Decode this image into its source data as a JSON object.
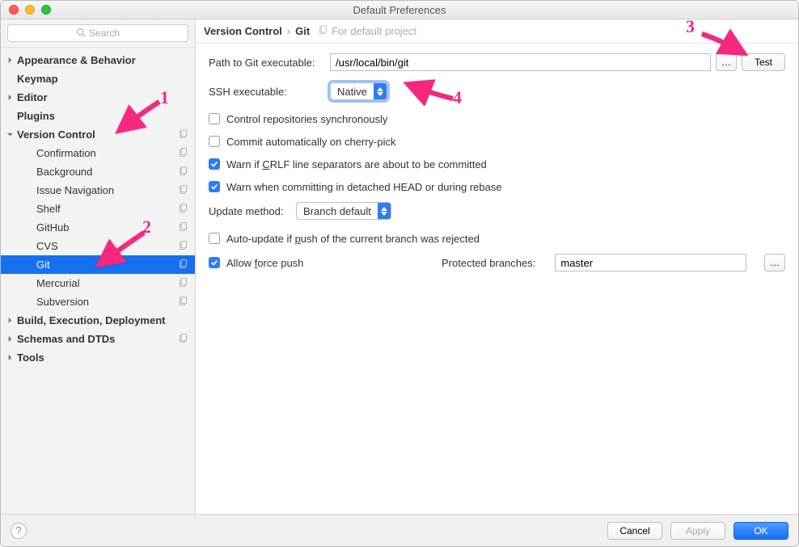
{
  "window": {
    "title": "Default Preferences"
  },
  "search": {
    "placeholder": "Search"
  },
  "sidebar": {
    "items": [
      {
        "kind": "group",
        "label": "Appearance & Behavior",
        "arrow": "right"
      },
      {
        "kind": "group",
        "label": "Keymap"
      },
      {
        "kind": "group",
        "label": "Editor",
        "arrow": "right"
      },
      {
        "kind": "group",
        "label": "Plugins"
      },
      {
        "kind": "group",
        "label": "Version Control",
        "arrow": "down",
        "copy": true
      },
      {
        "kind": "sub",
        "label": "Confirmation",
        "copy": true
      },
      {
        "kind": "sub",
        "label": "Background",
        "copy": true
      },
      {
        "kind": "sub",
        "label": "Issue Navigation",
        "copy": true
      },
      {
        "kind": "sub",
        "label": "Shelf",
        "copy": true
      },
      {
        "kind": "sub",
        "label": "GitHub",
        "copy": true
      },
      {
        "kind": "sub",
        "label": "CVS",
        "copy": true
      },
      {
        "kind": "sub",
        "label": "Git",
        "copy": true,
        "selected": true
      },
      {
        "kind": "sub",
        "label": "Mercurial",
        "copy": true
      },
      {
        "kind": "sub",
        "label": "Subversion",
        "copy": true
      },
      {
        "kind": "group",
        "label": "Build, Execution, Deployment",
        "arrow": "right"
      },
      {
        "kind": "group",
        "label": "Schemas and DTDs",
        "arrow": "right",
        "copy": true
      },
      {
        "kind": "group",
        "label": "Tools",
        "arrow": "right"
      }
    ]
  },
  "breadcrumb": {
    "root": "Version Control",
    "leaf": "Git",
    "note": "For default project"
  },
  "form": {
    "path_label": "Path to Git executable:",
    "path_value": "/usr/local/bin/git",
    "browse": "…",
    "test": "Test",
    "ssh_label": "SSH executable:",
    "ssh_value": "Native",
    "cb_sync": "Control repositories synchronously",
    "cb_cherry": "Commit automatically on cherry-pick",
    "cb_crlf_pre": "Warn if ",
    "cb_crlf_u": "C",
    "cb_crlf_post": "RLF line separators are about to be committed",
    "cb_detached": "Warn when committing in detached HEAD or during rebase",
    "update_label": "Update method:",
    "update_value": "Branch default",
    "cb_autoupdate_pre": "Auto-update if ",
    "cb_autoupdate_u": "p",
    "cb_autoupdate_post": "ush of the current branch was rejected",
    "cb_force_pre": "Allow ",
    "cb_force_u": "f",
    "cb_force_post": "orce push",
    "protected_label": "Protected branches:",
    "protected_value": "master"
  },
  "footer": {
    "cancel": "Cancel",
    "apply": "Apply",
    "ok": "OK"
  },
  "annotations": {
    "n1": "1",
    "n2": "2",
    "n3": "3",
    "n4": "4"
  }
}
